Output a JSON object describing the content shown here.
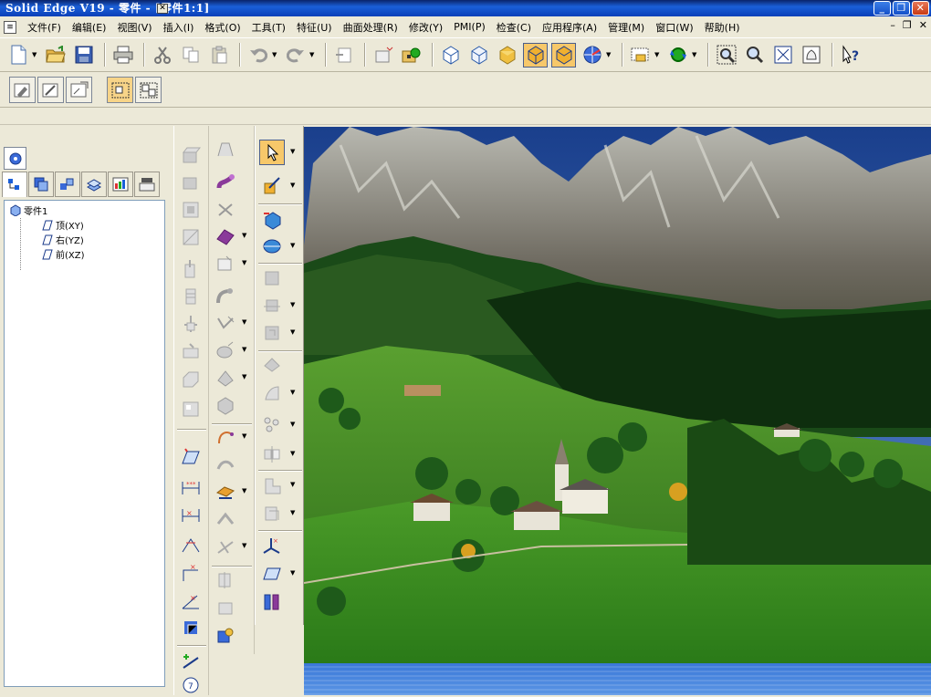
{
  "window": {
    "title": "Solid Edge V19 - 零件 - [零件1:1]",
    "buttons": {
      "minimize": "_",
      "restore": "❐",
      "close": "✕"
    }
  },
  "menubar": {
    "items": [
      "文件(F)",
      "编辑(E)",
      "视图(V)",
      "插入(I)",
      "格式(O)",
      "工具(T)",
      "特征(U)",
      "曲面处理(R)",
      "修改(Y)",
      "PMI(P)",
      "检查(C)",
      "应用程序(A)",
      "管理(M)",
      "窗口(W)",
      "帮助(H)"
    ],
    "mdi_controls": [
      "–",
      "❐",
      "✕"
    ]
  },
  "toolbar_main": {
    "icons": [
      "new-icon",
      "open-icon",
      "save-icon",
      "print-icon",
      "cut-icon",
      "copy-icon",
      "paste-icon",
      "undo-icon",
      "redo-icon",
      "paste-special-icon",
      "insert-part-icon",
      "material-icon",
      "view-iso-icon",
      "view-dimetric-icon",
      "view-shaded-icon",
      "shaded-edges-icon",
      "shaded-visible-icon",
      "render-sphere-icon",
      "zoom-window-icon",
      "rotate-icon",
      "zoom-area-icon",
      "zoom-icon",
      "fit-icon",
      "pan-icon",
      "help-icon"
    ]
  },
  "toolbar_secondary": {
    "icons": [
      "sketch-edit-icon",
      "sketch-icon",
      "sketch-dim-icon",
      "selection-mode-icon",
      "selection-mode-2-icon"
    ]
  },
  "pathfinder": {
    "tabs": [
      "feature-pathfinder-tab",
      "layers-tab",
      "assembly-tab",
      "sketch-tab",
      "library-tab",
      "family-tab"
    ],
    "tree": {
      "root": "零件1",
      "children": [
        "顶(XY)",
        "右(YZ)",
        "前(XZ)"
      ]
    }
  },
  "colors": {
    "titlebar": "#0a246a",
    "accent": "#f7c86a",
    "panel": "#ece9d8"
  }
}
